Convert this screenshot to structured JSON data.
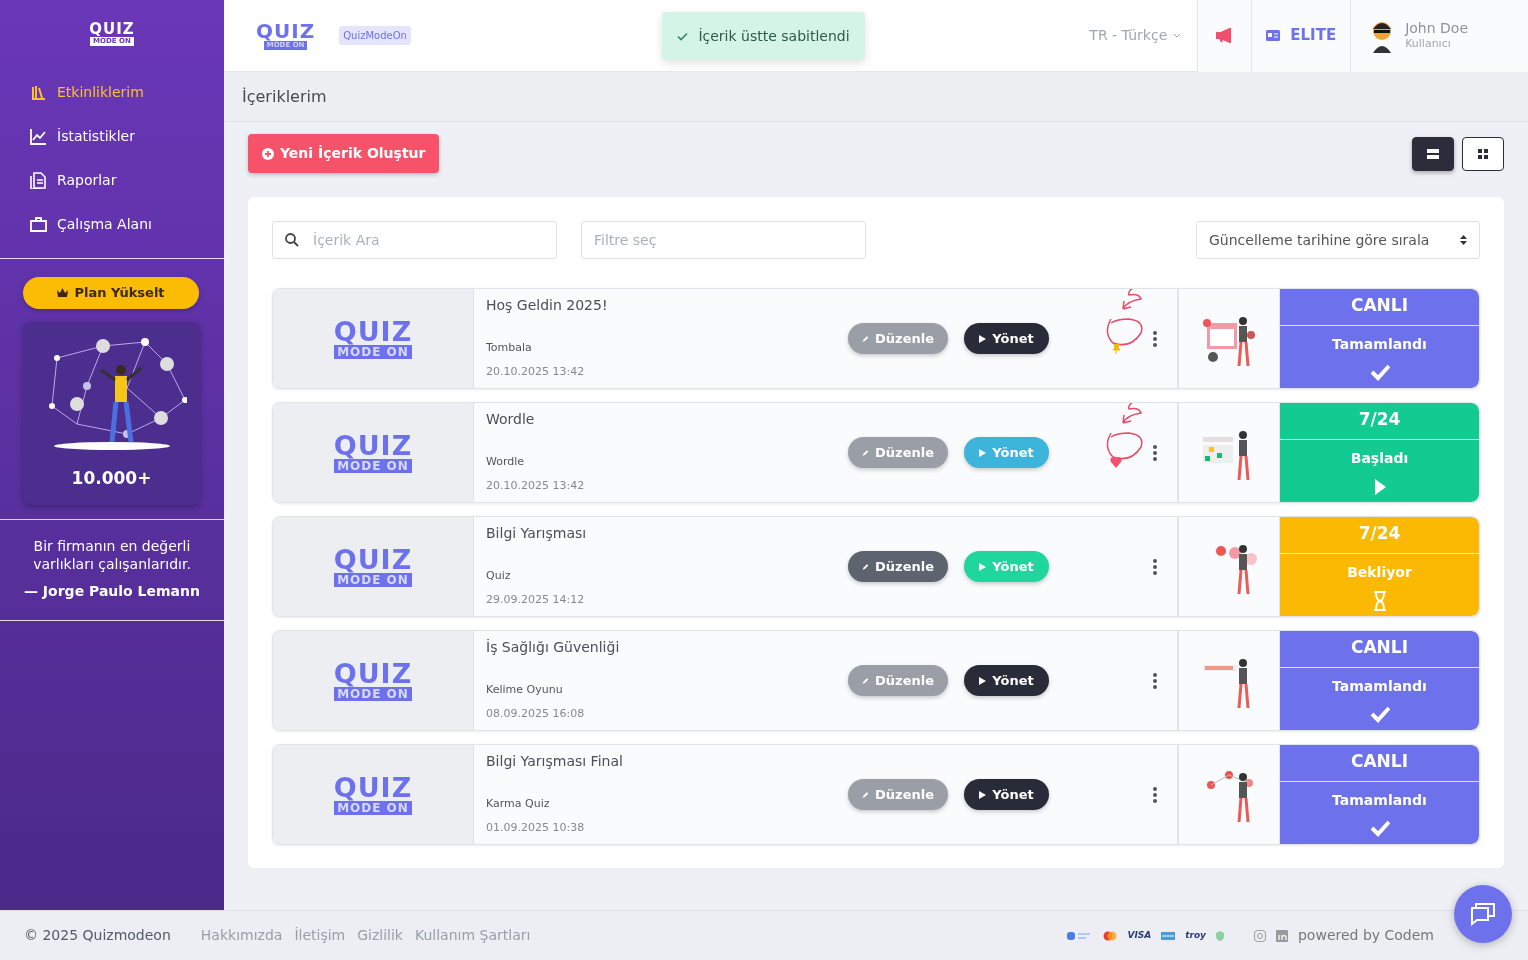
{
  "sidebar": {
    "logo": {
      "word": "QUIZ",
      "tag": "MODE ON"
    },
    "nav": [
      {
        "label": "Etkinliklerim",
        "selected": true
      },
      {
        "label": "İstatistikler",
        "selected": false
      },
      {
        "label": "Raporlar",
        "selected": false
      },
      {
        "label": "Çalışma Alanı",
        "selected": false
      }
    ],
    "upgrade_button": "Plan Yükselt",
    "promo": {
      "count": "10.000+"
    },
    "quote": {
      "text": "Bir firmanın en değerli varlıkları çalışanlarıdır.",
      "author": "— Jorge Paulo Lemann"
    }
  },
  "header": {
    "logo": {
      "word": "QUIZ",
      "tag": "MODE ON"
    },
    "badge": "QuizModeOn",
    "toast": "İçerik üstte sabitlendi",
    "language": "TR - Türkçe",
    "plan": "ELITE",
    "user": {
      "name": "John Doe",
      "role": "Kullanıcı"
    }
  },
  "page_title": "İçeriklerim",
  "create_button": "Yeni İçerik Oluştur",
  "view_toggle": [
    {
      "kind": "list",
      "selected": true
    },
    {
      "kind": "grid",
      "selected": false
    }
  ],
  "filters": {
    "search": {
      "placeholder": "İçerik Ara"
    },
    "filter": {
      "placeholder": "Filtre seç"
    },
    "sort": {
      "value": "Güncelleme tarihine göre sırala"
    }
  },
  "items": [
    {
      "thumb": {
        "word": "QUIZ",
        "tag": "MODE ON"
      },
      "title": "Hoş Geldin 2025!",
      "category": "Tombala",
      "date": "20.10.2025 13:42",
      "edit_button": {
        "label": "Düzenle",
        "color": "#9a9ea6"
      },
      "manage_button": {
        "label": "Yönet",
        "color": "#282b38"
      },
      "pinned": true,
      "favorite": false,
      "annotated": true,
      "status": {
        "header": "CANLI",
        "label": "Tamamlandı",
        "kind": "done",
        "color": "#6d71ec"
      }
    },
    {
      "thumb": {
        "word": "QUIZ",
        "tag": "MODE ON"
      },
      "title": "Wordle",
      "category": "Wordle",
      "date": "20.10.2025 13:42",
      "edit_button": {
        "label": "Düzenle",
        "color": "#9a9ea6"
      },
      "manage_button": {
        "label": "Yönet",
        "color": "#3cb4dc"
      },
      "pinned": false,
      "favorite": true,
      "annotated": true,
      "status": {
        "header": "7/24",
        "label": "Başladı",
        "kind": "started",
        "color": "#13ca90"
      }
    },
    {
      "thumb": {
        "word": "QUIZ",
        "tag": "MODE ON"
      },
      "title": "Bilgi Yarışması",
      "category": "Quiz",
      "date": "29.09.2025 14:12",
      "edit_button": {
        "label": "Düzenle",
        "color": "#5d6470"
      },
      "manage_button": {
        "label": "Yönet",
        "color": "#1fd69d"
      },
      "pinned": false,
      "favorite": false,
      "annotated": false,
      "status": {
        "header": "7/24",
        "label": "Bekliyor",
        "kind": "waiting",
        "color": "#fbb903"
      }
    },
    {
      "thumb": {
        "word": "QUIZ",
        "tag": "MODE ON"
      },
      "title": "İş Sağlığı Güvenliği",
      "category": "Kelime Oyunu",
      "date": "08.09.2025 16:08",
      "edit_button": {
        "label": "Düzenle",
        "color": "#9a9ea6"
      },
      "manage_button": {
        "label": "Yönet",
        "color": "#282b38"
      },
      "pinned": false,
      "favorite": false,
      "annotated": false,
      "status": {
        "header": "CANLI",
        "label": "Tamamlandı",
        "kind": "done",
        "color": "#6d71ec"
      }
    },
    {
      "thumb": {
        "word": "QUIZ",
        "tag": "MODE ON"
      },
      "title": "Bilgi Yarışması Final",
      "category": "Karma Quiz",
      "date": "01.09.2025 10:38",
      "edit_button": {
        "label": "Düzenle",
        "color": "#9a9ea6"
      },
      "manage_button": {
        "label": "Yönet",
        "color": "#282b38"
      },
      "pinned": false,
      "favorite": false,
      "annotated": false,
      "status": {
        "header": "CANLI",
        "label": "Tamamlandı",
        "kind": "done",
        "color": "#6d71ec"
      }
    }
  ],
  "footer": {
    "copyright": "© 2025 Quizmodeon",
    "links": [
      "Hakkımızda",
      "İletişim",
      "Gizlilik",
      "Kullanım Şartları"
    ],
    "payments": [
      "VISA",
      "troy"
    ],
    "powered": "powered by Codem"
  }
}
